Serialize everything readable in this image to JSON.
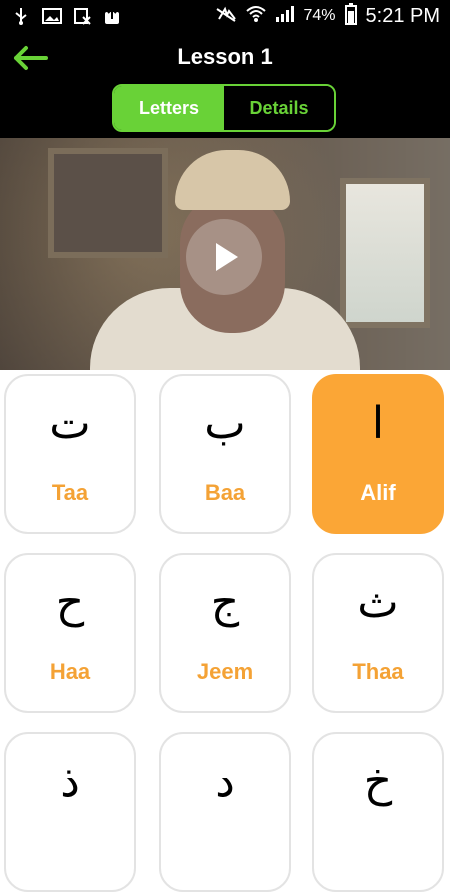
{
  "status_bar": {
    "battery_pct": "74%",
    "time": "5:21 PM"
  },
  "header": {
    "title": "Lesson 1",
    "segments": [
      "Letters",
      "Details"
    ]
  },
  "video": {
    "play_icon": "play-icon"
  },
  "letters": [
    {
      "arabic": "ت",
      "name": "Taa"
    },
    {
      "arabic": "ب",
      "name": "Baa"
    },
    {
      "arabic": "ا",
      "name": "Alif"
    },
    {
      "arabic": "ح",
      "name": "Haa"
    },
    {
      "arabic": "ج",
      "name": "Jeem"
    },
    {
      "arabic": "ث",
      "name": "Thaa"
    },
    {
      "arabic": "ذ",
      "name": ""
    },
    {
      "arabic": "د",
      "name": ""
    },
    {
      "arabic": "خ",
      "name": ""
    }
  ],
  "colors": {
    "accent_green": "#69d237",
    "accent_orange": "#fba636"
  }
}
